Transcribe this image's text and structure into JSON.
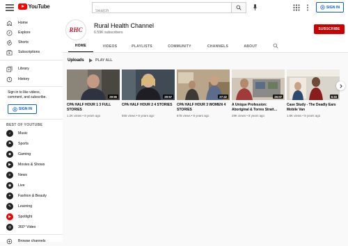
{
  "app": {
    "logo_text": "YouTube"
  },
  "search": {
    "placeholder": "Search"
  },
  "topbar": {
    "signin_label": "SIGN IN"
  },
  "sidebar": {
    "primary": [
      {
        "label": "Home",
        "icon": "home-icon"
      },
      {
        "label": "Explore",
        "icon": "compass-icon"
      },
      {
        "label": "Shorts",
        "icon": "shorts-icon"
      },
      {
        "label": "Subscriptions",
        "icon": "subscriptions-icon"
      }
    ],
    "secondary": [
      {
        "label": "Library",
        "icon": "library-icon"
      },
      {
        "label": "History",
        "icon": "history-icon"
      }
    ],
    "signin_prompt": "Sign in to like videos, comment, and subscribe.",
    "signin_label": "SIGN IN",
    "best_heading": "BEST OF YOUTUBE",
    "categories": [
      {
        "label": "Music",
        "icon": "music-icon"
      },
      {
        "label": "Sports",
        "icon": "sports-icon"
      },
      {
        "label": "Gaming",
        "icon": "gaming-icon"
      },
      {
        "label": "Movies & Shows",
        "icon": "movies-icon"
      },
      {
        "label": "News",
        "icon": "news-icon"
      },
      {
        "label": "Live",
        "icon": "live-icon"
      },
      {
        "label": "Fashion & Beauty",
        "icon": "fashion-icon"
      },
      {
        "label": "Learning",
        "icon": "learning-icon"
      },
      {
        "label": "Spotlight",
        "icon": "spotlight-icon"
      },
      {
        "label": "360° Video",
        "icon": "360-video-icon"
      }
    ],
    "browse_channels": "Browse channels"
  },
  "channel": {
    "avatar_text": "RHC",
    "name": "Rural Health Channel",
    "subscribers": "6.59K subscribers",
    "subscribe_label": "SUBSCRIBE"
  },
  "tabs": [
    {
      "label": "HOME",
      "active": true
    },
    {
      "label": "VIDEOS"
    },
    {
      "label": "PLAYLISTS"
    },
    {
      "label": "COMMUNITY"
    },
    {
      "label": "CHANNELS"
    },
    {
      "label": "ABOUT"
    }
  ],
  "shelf": {
    "title": "Uploads",
    "play_all": "PLAY ALL"
  },
  "videos": [
    {
      "title": "CPA HALF HOUR 1 3 FULL STORIES",
      "meta": "1.2K views • 8 years ago",
      "duration": "29:55"
    },
    {
      "title": "CPA HALF HOUR 2 4 STORIES",
      "meta": "556 views • 8 years ago",
      "duration": "29:57"
    },
    {
      "title": "CPA HALF HOUR 3 WOMEN 4 STORIES",
      "meta": "678 views • 8 years ago",
      "duration": "27:42"
    },
    {
      "title": "A Unique Profession: Aboriginal & Torres Strait…",
      "meta": "29K views • 8 years ago",
      "duration": "26:07"
    },
    {
      "title": "Case Study - The Deadly Ears Mobile Van",
      "meta": "1.8K views • 8 years ago",
      "duration": "5:33"
    }
  ],
  "colors": {
    "brand_red": "#ff0000",
    "subscribe_red": "#cc0000",
    "link_blue": "#065fd4"
  }
}
